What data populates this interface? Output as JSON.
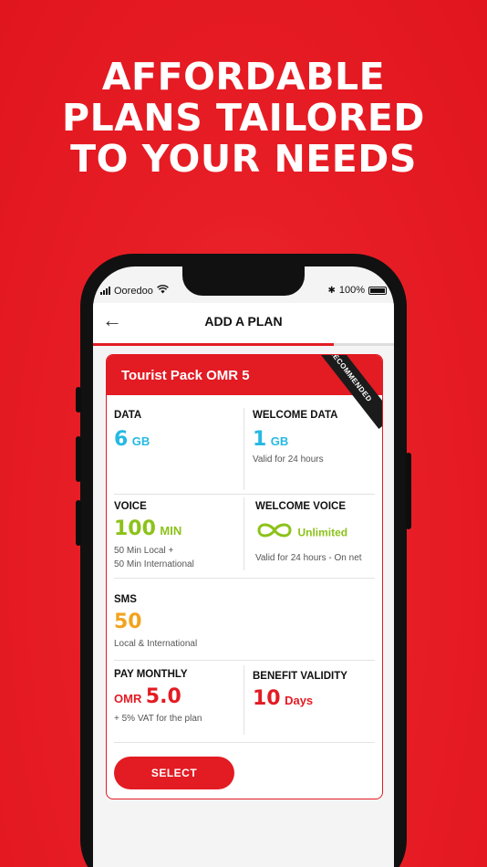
{
  "headline": [
    "AFFORDABLE",
    "PLANS TAILORED",
    "TO YOUR NEEDS"
  ],
  "status": {
    "carrier": "Ooredoo",
    "battery": "100%"
  },
  "appbar": {
    "title": "ADD A PLAN"
  },
  "progress": {
    "fraction": 0.8
  },
  "plan": {
    "name": "Tourist Pack OMR 5",
    "badge": "RECOMMENDED",
    "data": {
      "label": "DATA",
      "value": "6",
      "unit": "GB"
    },
    "welcome_data": {
      "label": "WELCOME DATA",
      "value": "1",
      "unit": "GB",
      "note": "Valid for 24 hours"
    },
    "voice": {
      "label": "VOICE",
      "value": "100",
      "unit": "MIN",
      "note1": "50 Min Local +",
      "note2": "50 Min International"
    },
    "welcome_voice": {
      "label": "WELCOME VOICE",
      "value": "Unlimited",
      "note": "Valid for 24 hours - On net"
    },
    "sms": {
      "label": "SMS",
      "value": "50",
      "note": "Local & International"
    },
    "pay": {
      "label": "PAY MONTHLY",
      "currency": "OMR",
      "value": "5.0",
      "note": "+ 5% VAT for the plan"
    },
    "validity": {
      "label": "BENEFIT VALIDITY",
      "value": "10",
      "unit": "Days"
    },
    "select_label": "SELECT"
  },
  "colors": {
    "brand": "#e31b23",
    "data": "#26b9e3",
    "voice": "#8cc21a",
    "sms": "#f1a31f"
  }
}
